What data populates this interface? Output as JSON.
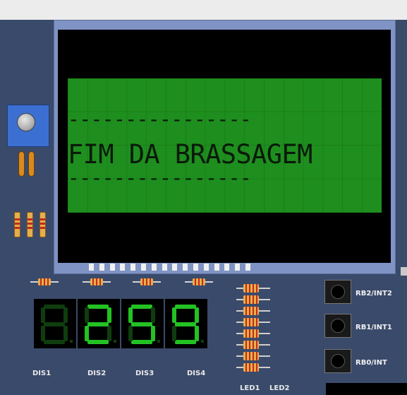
{
  "lcd": {
    "row1": "----------------",
    "row2": "FIM DA BRASSAGEM",
    "row3": "----------------"
  },
  "displays": [
    {
      "label": "DIS1",
      "digit": "8",
      "lit": false
    },
    {
      "label": "DIS2",
      "digit": "2",
      "lit": true
    },
    {
      "label": "DIS3",
      "digit": "5",
      "lit": true
    },
    {
      "label": "DIS4",
      "digit": "9",
      "lit": true
    }
  ],
  "leds": {
    "labels": [
      "LED1",
      "LED2"
    ]
  },
  "buttons": [
    {
      "label": "RB2/INT2"
    },
    {
      "label": "RB1/INT1"
    },
    {
      "label": "RB0/INT"
    }
  ],
  "colors": {
    "board": "#3a4a6b",
    "lcd_green": "#1e8e1e",
    "segment_on": "#23c223",
    "segment_off": "#0f3d0f"
  }
}
